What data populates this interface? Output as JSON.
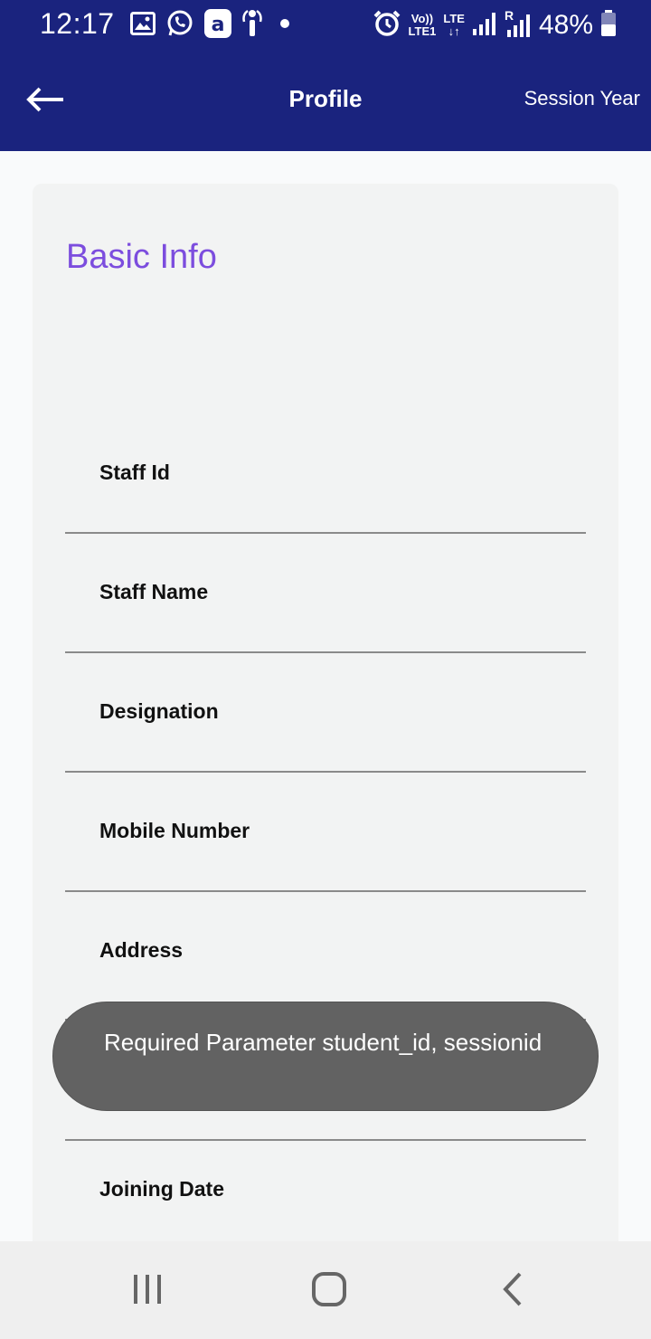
{
  "status_bar": {
    "time": "12:17",
    "icons_left": [
      "gallery-icon",
      "whatsapp-icon",
      "a-app-icon",
      "info-icon",
      "dot-icon"
    ],
    "volte_top": "Vo))",
    "volte_bottom": "LTE1",
    "lte_label": "LTE",
    "roaming_label": "R",
    "battery": "48%",
    "bg_color": "#1a237e"
  },
  "app_bar": {
    "title": "Profile",
    "action_label": "Session Year",
    "back_icon": "arrow-left-icon"
  },
  "card": {
    "title": "Basic Info",
    "title_color": "#7c4dde",
    "fields": [
      {
        "label": "Staff Id"
      },
      {
        "label": "Staff Name"
      },
      {
        "label": "Designation"
      },
      {
        "label": "Mobile Number"
      },
      {
        "label": "Address"
      },
      {
        "label": "Joining Date"
      }
    ]
  },
  "toast": {
    "message": "Required Parameter student_id, sessionid"
  },
  "nav_bar": {
    "recents_icon": "recents-icon",
    "home_icon": "home-icon",
    "back_icon": "back-chevron-icon"
  }
}
